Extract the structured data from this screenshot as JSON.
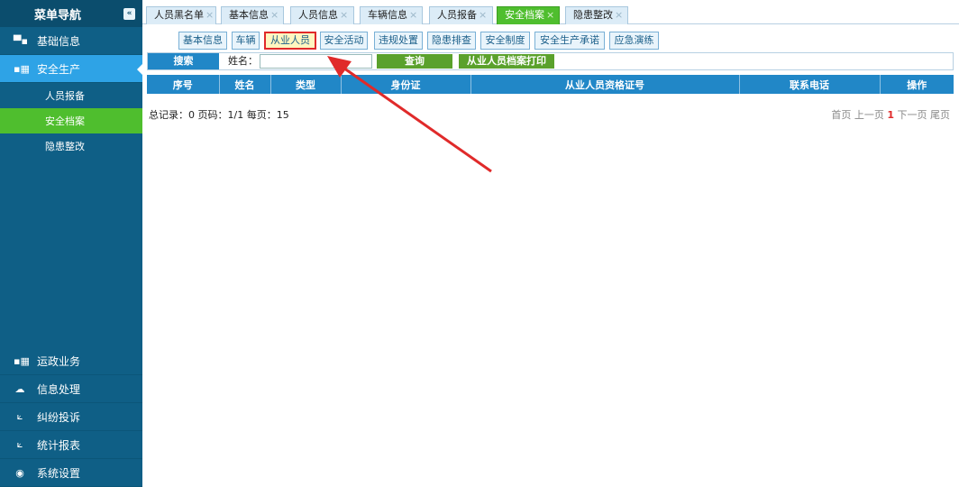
{
  "sidebar": {
    "title": "菜单导航",
    "collapse_icon": "«",
    "items": [
      {
        "label": "基础信息",
        "icon": "card-icon"
      },
      {
        "label": "安全生产",
        "icon": "building-icon"
      }
    ],
    "subitems": [
      "人员报备",
      "安全档案",
      "隐患整改"
    ],
    "bottom_items": [
      {
        "label": "运政业务",
        "icon": "building-icon"
      },
      {
        "label": "信息处理",
        "icon": "cloud-icon"
      },
      {
        "label": "纠纷投诉",
        "icon": "chart-icon"
      },
      {
        "label": "统计报表",
        "icon": "chart-icon"
      },
      {
        "label": "系统设置",
        "icon": "eye-icon"
      }
    ]
  },
  "tabs": [
    "人员黑名单",
    "基本信息",
    "人员信息",
    "车辆信息",
    "人员报备",
    "安全档案",
    "隐患整改"
  ],
  "tab_close": "×",
  "subtabs": [
    "基本信息",
    "车辆",
    "从业人员",
    "安全活动",
    "违规处置",
    "隐患排查",
    "安全制度",
    "安全生产承诺",
    "应急演练"
  ],
  "search": {
    "title": "搜索",
    "name_label": "姓名：",
    "name_value": "",
    "query_button": "查询",
    "print_button": "从业人员档案打印"
  },
  "table": {
    "headers": [
      "序号",
      "姓名",
      "类型",
      "身份证",
      "从业人员资格证号",
      "联系电话",
      "操作"
    ],
    "rows": []
  },
  "pager": {
    "summary": "总记录：0 页码：1/1 每页：15",
    "first": "首页",
    "prev": "上一页",
    "current": "1",
    "next": "下一页",
    "last": "尾页"
  },
  "colors": {
    "sidebar_bg": "#0f5f86",
    "active_blue": "#2ea3e6",
    "active_green": "#4fbe2e",
    "header_blue": "#2187c7",
    "annotation_red": "#e02a2a"
  }
}
